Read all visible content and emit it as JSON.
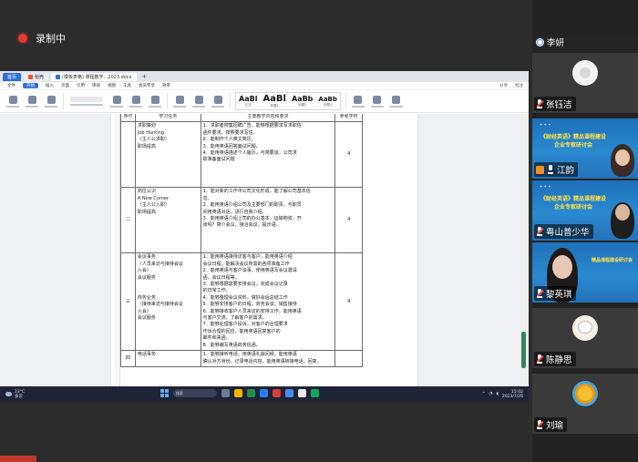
{
  "recording": {
    "label": "录制中"
  },
  "screen": {
    "tabs": [
      {
        "label": "首页",
        "type": "home"
      },
      {
        "label": "稻壳",
        "type": "normal"
      },
      {
        "label": "(模板表格) 课程教学...2023.docx",
        "type": "active"
      }
    ],
    "menu": [
      "文件",
      "开始",
      "插入",
      "页面",
      "引用",
      "审阅",
      "视图",
      "工具",
      "会员专享",
      "效率"
    ],
    "menu_right": [
      "分享",
      "批注"
    ],
    "styles": [
      {
        "preview": "AaBl",
        "name": "正文"
      },
      {
        "preview": "AaBl",
        "name": "标题1"
      },
      {
        "preview": "AaBb",
        "name": "标题2"
      },
      {
        "preview": "AaBb",
        "name": "标题3"
      }
    ],
    "table": {
      "headers": [
        "序号",
        "学习任务",
        "主要教学内容和要求",
        "参考学时"
      ],
      "rows": [
        {
          "seq": "",
          "task": [
            "求职策划",
            "Job Hunting",
            "（主人公求职）",
            "职场提高"
          ],
          "req": [
            "1．求职者搜集招聘广告，能够根据要求写求职信",
            "函件要求，按照要求写信。",
            "2．能制作个人英文简历。",
            "3．能用英语回答面试问题。",
            "4．能用英语描述个人履历，与简要谈，公司求",
            "职准备面试问题"
          ],
          "score": "4"
        },
        {
          "seq": "二",
          "task": [
            "岗位认识",
            "A New Comer",
            "（主人公入职）",
            "职场提高"
          ],
          "req": [
            "1．能对新的工作中公司文化形成，能了解公司基本信",
            "息。",
            "2．能用英语介绍公司及主要部门的职责。与职员",
            "间用英语对话，进行自我介绍。",
            "3．能用英语介绍上司的办公基本，运输物资，开",
            "张吗？简介会议，接洽会议，提示语。"
          ],
          "score": "4"
        },
        {
          "seq": "三",
          "task": [
            "会议事务",
            "（人员来访与接待会议",
            "入会）",
            "会议服务",
            "",
            "",
            "商务业务",
            "（接待来访与接待会议",
            "入会）",
            "会议服务"
          ],
          "req": [
            "1．能用英语接待访客与客户，能用英语介绍",
            "会议日程，能解决会议所需的各项准备工作",
            "2．能用英语与客户谈事，使用英语写会议邀请",
            "函，会议日程等。",
            "3．能够根据需要安排会议，完成会议记录",
            "的日常工作。",
            "4．能够整理会议资料，做好会后总结工作",
            "5．能够安排客户的日程，商务会谈，销售接待",
            "6．能够接收客户人员来访的安排工作，能用英语",
            "与客户交流，了解客户的需求。",
            "7．能够处理客户投诉，对客户的合理要求",
            "作出合理的回应，能用英语回复客户的",
            "邮件和来函。",
            "8．能够编写英语商务信函。"
          ],
          "score": "4"
        },
        {
          "seq": "四",
          "task": [
            "电话事务"
          ],
          "req": [
            "1．能够接听电话，用英语礼貌问候，能用英语",
            "确认对方身份，记录电话内容，能用英语转接电话，回复。"
          ],
          "score": ""
        }
      ]
    },
    "statusbar": {
      "left": [
        "页码：1",
        "页面：1/4",
        "字数：1,858",
        "拼写检查"
      ],
      "zoom": "140%"
    },
    "taskbar": {
      "weather_temp": "23°C",
      "weather_desc": "多云",
      "search_placeholder": "搜索",
      "time": "15:02",
      "date": "2023/7/26"
    }
  },
  "participants": [
    {
      "name": "李妍",
      "kind": "name-only",
      "mic": "host"
    },
    {
      "name": "张钰洁",
      "kind": "avatar",
      "avatar_color": "#f2f2f2",
      "mic": "muted"
    },
    {
      "name": "江韵",
      "kind": "slide",
      "slide_text": "《财经英语》精品课程建设企业专家研讨会",
      "mic": "on"
    },
    {
      "name": "粤山普少华",
      "kind": "slide",
      "slide_text": "《财经英语》精品课程建设企业专家研讨会",
      "mic": "muted"
    },
    {
      "name": "黎英琪",
      "kind": "slide",
      "slide_text": "精品课程建设研讨会",
      "mic": "muted"
    },
    {
      "name": "陈静思",
      "kind": "avatar",
      "avatar_color": "#f5f0e8",
      "mic": "muted"
    },
    {
      "name": "刘瑜",
      "kind": "avatar",
      "avatar_color": "#4aa3d8",
      "mic": "muted"
    }
  ]
}
